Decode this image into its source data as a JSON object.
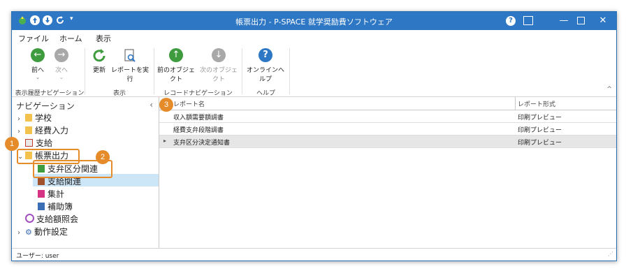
{
  "titlebar": {
    "title": "帳票出力 - P-SPACE 就学奨励費ソフトウェア"
  },
  "menu": {
    "items": [
      "ファイル",
      "ホーム",
      "表示"
    ]
  },
  "ribbon": {
    "back": "前へ",
    "forward": "次へ",
    "refresh": "更新",
    "run_report": "レポートを実行",
    "prev_object": "前のオブジェクト",
    "next_object": "次のオブジェクト",
    "online_help": "オンラインヘルプ",
    "groups": [
      "表示履歴ナビゲーション",
      "表示",
      "レコードナビゲーション",
      "ヘルプ"
    ]
  },
  "nav": {
    "title": "ナビゲーション",
    "items": [
      "学校",
      "経費入力",
      "支給",
      "帳票出力",
      "支弁区分関連",
      "支給関連",
      "集計",
      "補助簿",
      "支給額照会",
      "動作設定"
    ]
  },
  "grid": {
    "columns": [
      "レポート名",
      "レポート形式"
    ],
    "rows": [
      {
        "name": "収入額需要額調書",
        "format": "印刷プレビュー"
      },
      {
        "name": "経費支弁段階調書",
        "format": "印刷プレビュー"
      },
      {
        "name": "支弁区分決定通知書",
        "format": "印刷プレビュー"
      }
    ]
  },
  "status": {
    "user": "ユーザー: user"
  },
  "annotations": [
    "1",
    "2",
    "3"
  ],
  "colors": {
    "accent": "#2e77c4",
    "badge": "#e58b2a",
    "selection": "#cde6f7",
    "green": "#3e9b3e"
  }
}
